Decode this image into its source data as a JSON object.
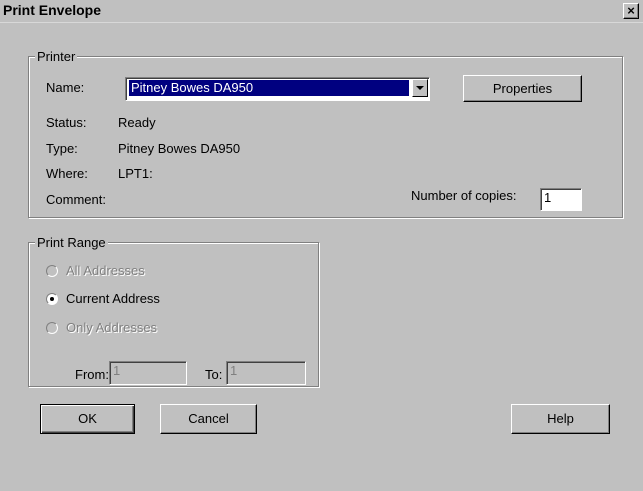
{
  "window": {
    "title": "Print Envelope",
    "close_glyph": "×"
  },
  "printer_group": {
    "legend": "Printer",
    "name_label": "Name:",
    "name_value": "Pitney Bowes DA950",
    "properties_button": "Properties",
    "status_label": "Status:",
    "status_value": "Ready",
    "type_label": "Type:",
    "type_value": "Pitney Bowes DA950",
    "where_label": "Where:",
    "where_value": "LPT1:",
    "comment_label": "Comment:",
    "copies_label": "Number of copies:",
    "copies_value": "1"
  },
  "print_range": {
    "legend": "Print Range",
    "options": [
      {
        "label": "All Addresses",
        "enabled": false,
        "selected": false
      },
      {
        "label": "Current Address",
        "enabled": true,
        "selected": true
      },
      {
        "label": "Only Addresses",
        "enabled": false,
        "selected": false
      }
    ],
    "from_label": "From:",
    "from_value": "1",
    "to_label": "To:",
    "to_value": "1"
  },
  "buttons": {
    "ok": "OK",
    "cancel": "Cancel",
    "help": "Help"
  },
  "icons": {
    "close": "close-icon",
    "dropdown": "chevron-down-icon"
  },
  "colors": {
    "face": "#c0c0c0",
    "selection": "#000080",
    "disabled_text": "#808080"
  }
}
